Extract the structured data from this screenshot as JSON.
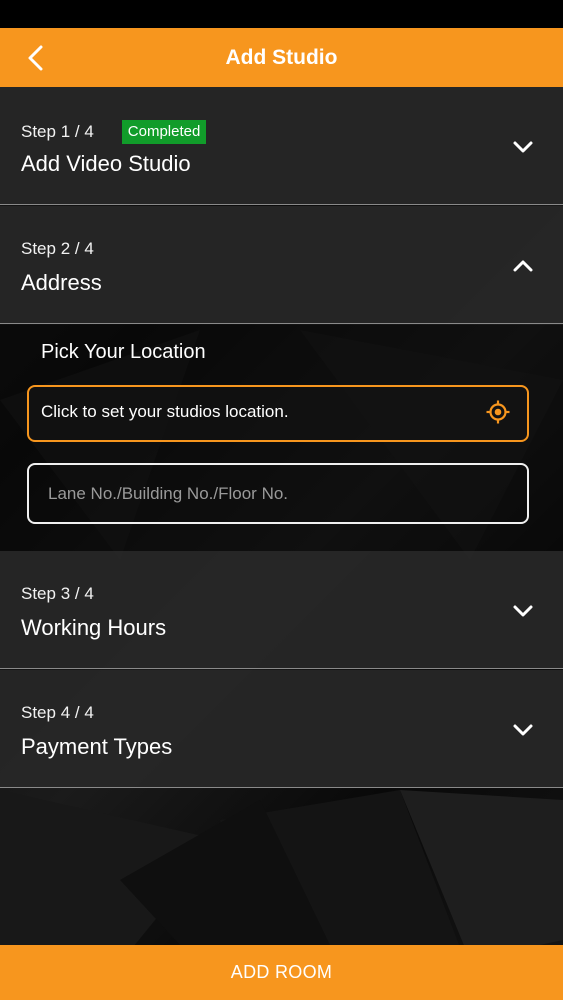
{
  "navbar": {
    "title": "Add Studio",
    "back_icon": "chevron-left-icon"
  },
  "steps": [
    {
      "step": "Step 1 / 4",
      "title": "Add Video Studio",
      "badge": "Completed",
      "state": "collapsed",
      "icon": "chevron-down-icon"
    },
    {
      "step": "Step 2 / 4",
      "title": "Address",
      "badge": "",
      "state": "expanded",
      "icon": "chevron-up-icon"
    },
    {
      "step": "Step 3 / 4",
      "title": "Working Hours",
      "badge": "",
      "state": "collapsed",
      "icon": "chevron-down-icon"
    },
    {
      "step": "Step 4 / 4",
      "title": "Payment Types",
      "badge": "",
      "state": "collapsed",
      "icon": "chevron-down-icon"
    }
  ],
  "address": {
    "pick_label": "Pick Your Location",
    "location_text": "Click to set your studios location.",
    "location_icon": "target-location-icon",
    "detail_placeholder": "Lane No./Building No./Floor No.",
    "detail_value": ""
  },
  "footer": {
    "button_label": "ADD ROOM"
  },
  "colors": {
    "accent": "#f7961e",
    "completed_badge": "#119c2a",
    "panel": "#262626"
  }
}
